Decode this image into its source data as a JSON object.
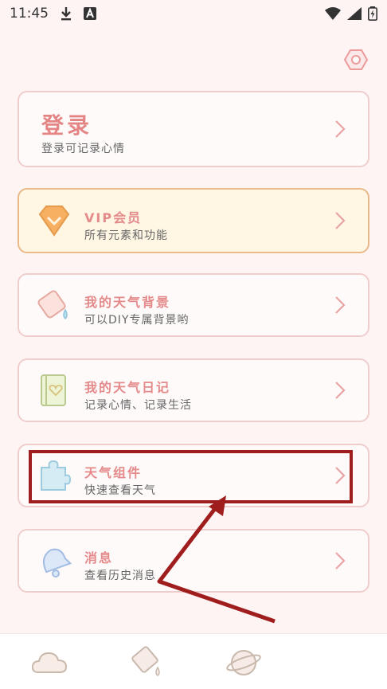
{
  "status_bar": {
    "time": "11:45",
    "icons": [
      "download-icon",
      "a-badge-icon",
      "wifi-icon",
      "signal-icon",
      "battery-icon"
    ]
  },
  "menu": {
    "login": {
      "title": "登录",
      "subtitle": "登录可记录心情"
    },
    "vip": {
      "title": "VIP会员",
      "subtitle": "所有元素和功能"
    },
    "background": {
      "title": "我的天气背景",
      "subtitle": "可以DIY专属背景哟"
    },
    "diary": {
      "title": "我的天气日记",
      "subtitle": "记录心情、记录生活"
    },
    "widget": {
      "title": "天气组件",
      "subtitle": "快速查看天气"
    },
    "messages": {
      "title": "消息",
      "subtitle": "查看历史消息"
    }
  },
  "tabbar": {
    "tabs": [
      "weather-tab-icon",
      "background-tab-icon",
      "profile-tab-icon"
    ]
  },
  "colors": {
    "accent_text": "#e48a8a",
    "card_border": "#f0cdcd",
    "vip_border": "#e9b987",
    "annotation_red": "#a01d1d"
  }
}
